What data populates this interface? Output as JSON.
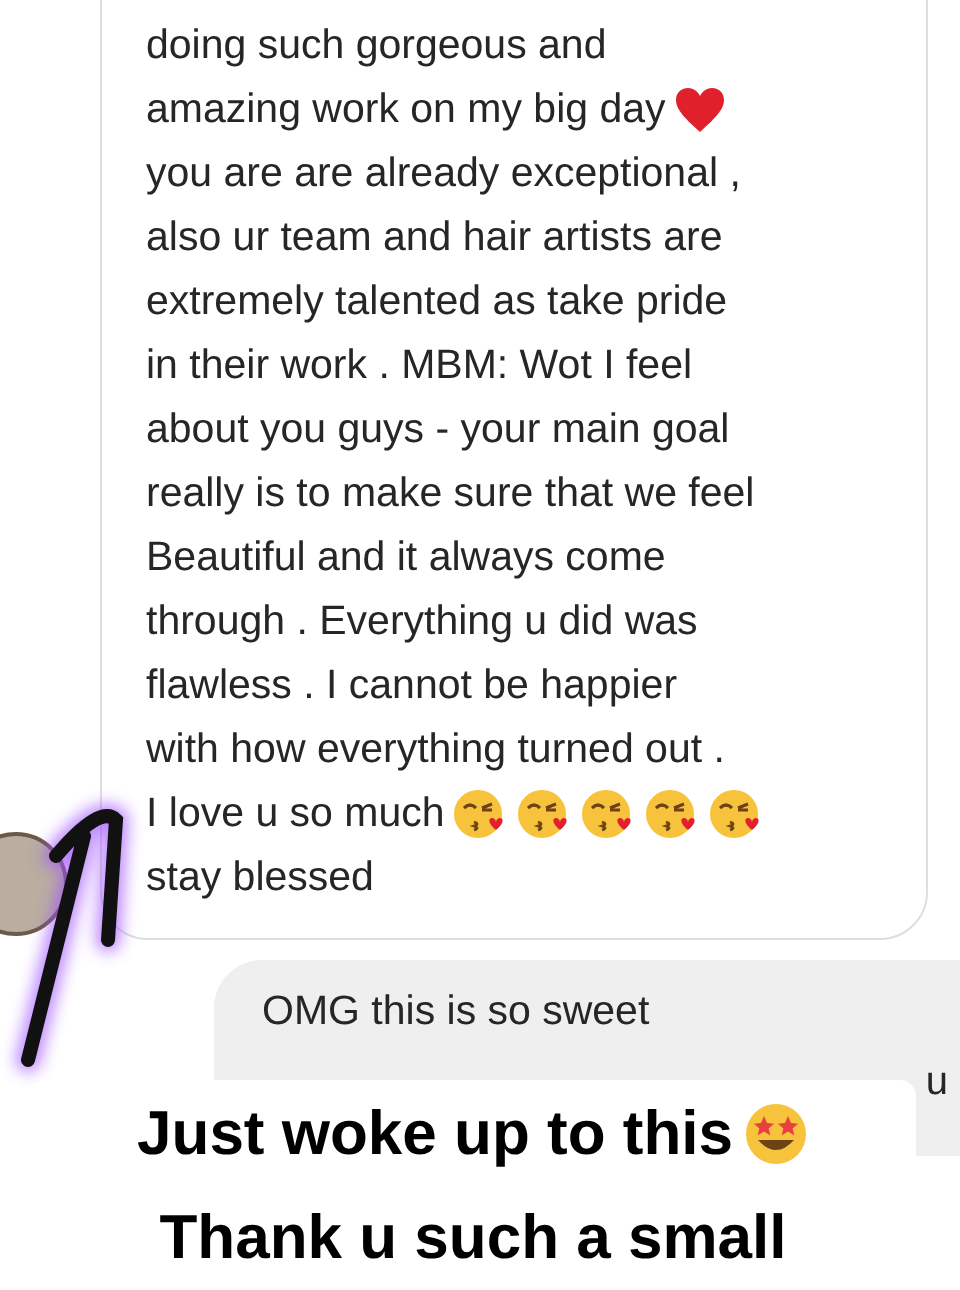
{
  "received_message": {
    "lines": [
      {
        "text": "doing such gorgeous and",
        "kind": "plain"
      },
      {
        "text": "amazing work on my big day",
        "kind": "heart"
      },
      {
        "text": "you are are already exceptional ,",
        "kind": "plain"
      },
      {
        "text": "also ur team and hair artists are",
        "kind": "plain"
      },
      {
        "text": "extremely talented as take pride",
        "kind": "plain"
      },
      {
        "text": "in their work . MBM: Wot I feel",
        "kind": "plain"
      },
      {
        "text": "about you guys - your main goal",
        "kind": "plain"
      },
      {
        "text": "really is to make sure that we feel",
        "kind": "plain"
      },
      {
        "text": "Beautiful and it always come",
        "kind": "plain"
      },
      {
        "text": "through . Everything u did was",
        "kind": "plain"
      },
      {
        "text": "flawless . I cannot be happier",
        "kind": "plain"
      },
      {
        "text": "with how everything turned out .",
        "kind": "plain"
      },
      {
        "text": "I love u so much",
        "kind": "kisses"
      },
      {
        "text": "stay blessed",
        "kind": "plain"
      }
    ]
  },
  "sent_message": {
    "text": "OMG this is so sweet"
  },
  "cut_text": "u",
  "caption": {
    "lines": [
      {
        "text": "Just woke up to this",
        "kind": "star_eyes"
      },
      {
        "text": "Thank u such a small",
        "kind": "plain"
      }
    ]
  }
}
